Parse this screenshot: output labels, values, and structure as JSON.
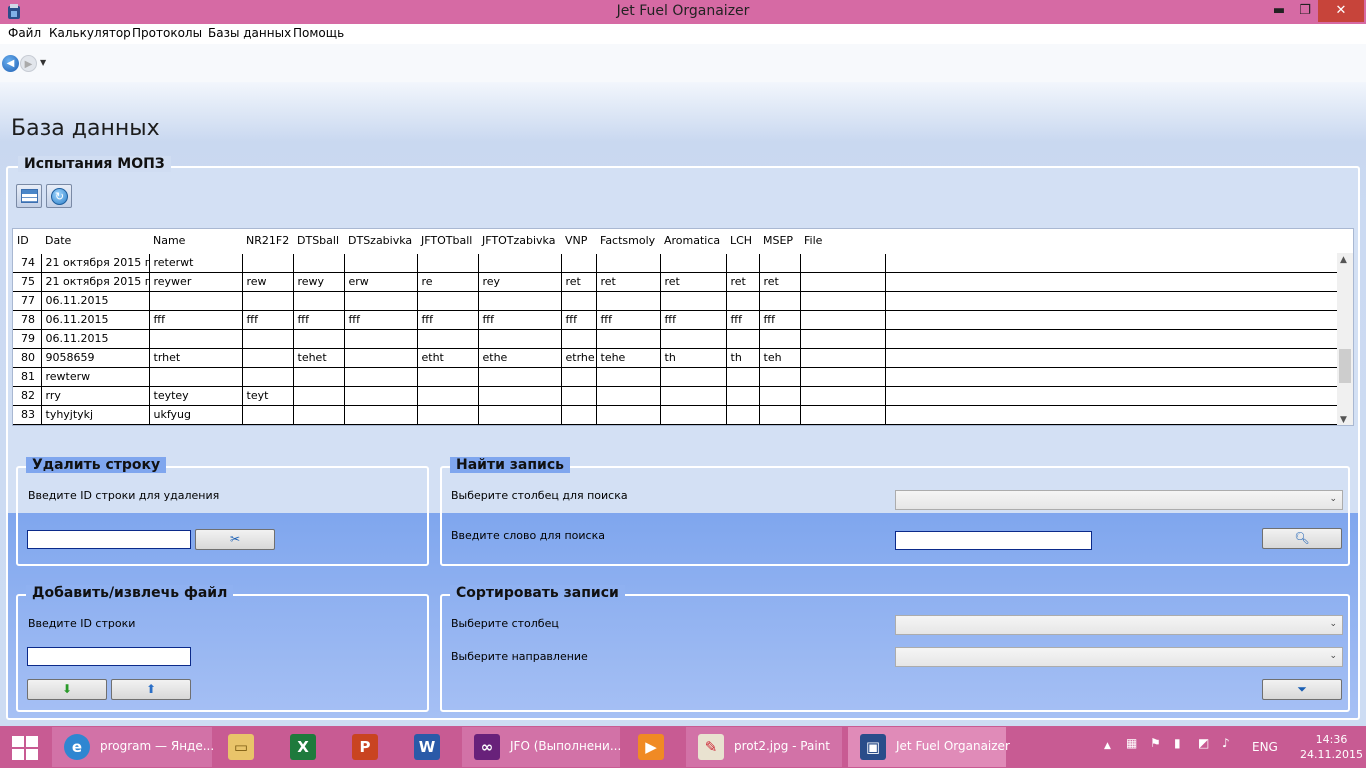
{
  "window": {
    "title": "Jet Fuel Organaizer",
    "minimize": "▬",
    "maximize": "❐",
    "close": "✕"
  },
  "menu": [
    "Файл",
    "Калькулятор",
    "Протоколы",
    "Базы данных",
    "Помощь"
  ],
  "page": {
    "title": "База данных"
  },
  "tests_group": {
    "legend": "Испытания МОПЗ"
  },
  "grid": {
    "columns": [
      "ID",
      "Date",
      "Name",
      "NR21F2",
      "DTSball",
      "DTSzabivka",
      "JFTOTball",
      "JFTOTzabivka",
      "VNP",
      "Factsmoly",
      "Aromatica",
      "LCH",
      "MSEP",
      "File"
    ],
    "rows": [
      [
        "74",
        "21 октября 2015 г.",
        "reterwt",
        "",
        "",
        "",
        "",
        "",
        "",
        "",
        "",
        "",
        "",
        ""
      ],
      [
        "75",
        "21 октября 2015 г.",
        "reywer",
        "rew",
        "rewy",
        "erw",
        "re",
        "rey",
        "ret",
        "ret",
        "ret",
        "ret",
        "ret",
        ""
      ],
      [
        "77",
        "06.11.2015",
        "",
        "",
        "",
        "",
        "",
        "",
        "",
        "",
        "",
        "",
        "",
        ""
      ],
      [
        "78",
        "06.11.2015",
        "fff",
        "fff",
        "fff",
        "fff",
        "fff",
        "fff",
        "fff",
        "fff",
        "fff",
        "fff",
        "fff",
        ""
      ],
      [
        "79",
        "06.11.2015",
        "",
        "",
        "",
        "",
        "",
        "",
        "",
        "",
        "",
        "",
        "",
        ""
      ],
      [
        "80",
        "9058659",
        "trhet",
        "",
        "tehet",
        "",
        "etht",
        "ethe",
        "etrhe",
        "tehe",
        "th",
        "th",
        "teh",
        ""
      ],
      [
        "81",
        "rewterw",
        "",
        "",
        "",
        "",
        "",
        "",
        "",
        "",
        "",
        "",
        "",
        ""
      ],
      [
        "82",
        "rry",
        "teytey",
        "teyt",
        "",
        "",
        "",
        "",
        "",
        "",
        "",
        "",
        "",
        ""
      ],
      [
        "83",
        "tyhyjtykj",
        "ukfyug",
        "",
        "",
        "",
        "",
        "",
        "",
        "",
        "",
        "",
        "",
        ""
      ]
    ]
  },
  "delete_group": {
    "legend": "Удалить строку",
    "prompt": "Введите ID строки для удаления",
    "input_value": "",
    "button_icon": "scissors-icon"
  },
  "search_group": {
    "legend": "Найти запись",
    "column_prompt": "Выберите столбец для поиска",
    "word_prompt": "Введите слово для поиска",
    "column_value": "",
    "word_value": "",
    "button_icon": "magnifier-icon"
  },
  "file_group": {
    "legend": "Добавить/извлечь файл",
    "prompt": "Введите ID строки",
    "input_value": ""
  },
  "sort_group": {
    "legend": "Сортировать записи",
    "column_prompt": "Выберите столбец",
    "direction_prompt": "Выберите направление",
    "column_value": "",
    "direction_value": "",
    "button_icon": "funnel-icon"
  },
  "taskbar": {
    "items": [
      {
        "label": "program — Янде...",
        "icon": "ie-icon"
      },
      {
        "label": "",
        "icon": "explorer-icon"
      },
      {
        "label": "",
        "icon": "excel-icon"
      },
      {
        "label": "",
        "icon": "powerpoint-icon"
      },
      {
        "label": "",
        "icon": "word-icon"
      },
      {
        "label": "JFO (Выполнени...",
        "icon": "visual-studio-icon"
      },
      {
        "label": "",
        "icon": "media-player-icon"
      },
      {
        "label": "prot2.jpg - Paint",
        "icon": "paint-icon"
      },
      {
        "label": "Jet Fuel Organaizer",
        "icon": "jfo-app-icon"
      }
    ],
    "language": "ENG",
    "time": "14:36",
    "date": "24.11.2015"
  },
  "colors": {
    "titlebar": "#d66aa4",
    "taskbar": "#c85b93",
    "panel_blue": "#7fa6ee"
  }
}
